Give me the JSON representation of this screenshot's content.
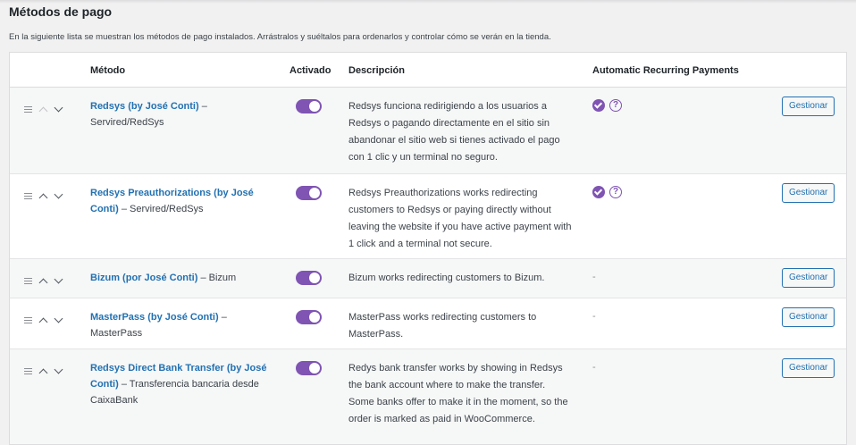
{
  "page": {
    "title": "Métodos de pago",
    "intro": "En la siguiente lista se muestran los métodos de pago instalados. Arrástralos y suéltalos para ordenarlos y controlar cómo se verán en la tienda."
  },
  "table": {
    "headers": {
      "method": "Método",
      "enabled": "Activado",
      "description": "Descripción",
      "arp": "Automatic Recurring Payments"
    },
    "rows": [
      {
        "name": "Redsys (by José Conti)",
        "suffix": " – Servired/RedSys",
        "enabled": true,
        "description": "Redsys funciona redirigiendo a los usuarios a Redsys o pagando directamente en el sitio sin abandonar el sitio web si tienes activado el pago con 1 clic y un terminal no seguro.",
        "arp": "",
        "button": "Gestionar"
      },
      {
        "name": "Redsys Preauthorizations (by José Conti)",
        "suffix": " – Servired/RedSys",
        "enabled": true,
        "description": "Redsys Preauthorizations works redirecting customers to Redsys or paying directly without leaving the website if you have active payment with 1 click and a terminal not secure.",
        "arp": "",
        "button": "Gestionar"
      },
      {
        "name": "Bizum (por José Conti)",
        "suffix": " – Bizum",
        "enabled": true,
        "description": "Bizum works redirecting customers to Bizum.",
        "arp": "-",
        "button": "Gestionar"
      },
      {
        "name": "MasterPass (by José Conti)",
        "suffix": " – MasterPass",
        "enabled": true,
        "description": "MasterPass works redirecting customers to MasterPass.",
        "arp": "-",
        "button": "Gestionar"
      },
      {
        "name": "Redsys Direct Bank Transfer (by José Conti)",
        "suffix": " – Transferencia bancaria desde CaixaBank",
        "enabled": true,
        "description": "Redys bank transfer works by showing in Redsys the bank account where to make the transfer. Some banks offer to make it in the moment, so the order is marked as paid in WooCommerce.",
        "arp": "-",
        "button": "Gestionar"
      }
    ]
  },
  "icons": {
    "drag": "drag-handle-icon",
    "up": "chevron-up-icon",
    "down": "chevron-down-icon",
    "supported": "check-circle-icon",
    "help": "help-icon"
  },
  "colors": {
    "accent": "#7f54b3",
    "link": "#2271b1",
    "background": "#f1f1f1"
  }
}
